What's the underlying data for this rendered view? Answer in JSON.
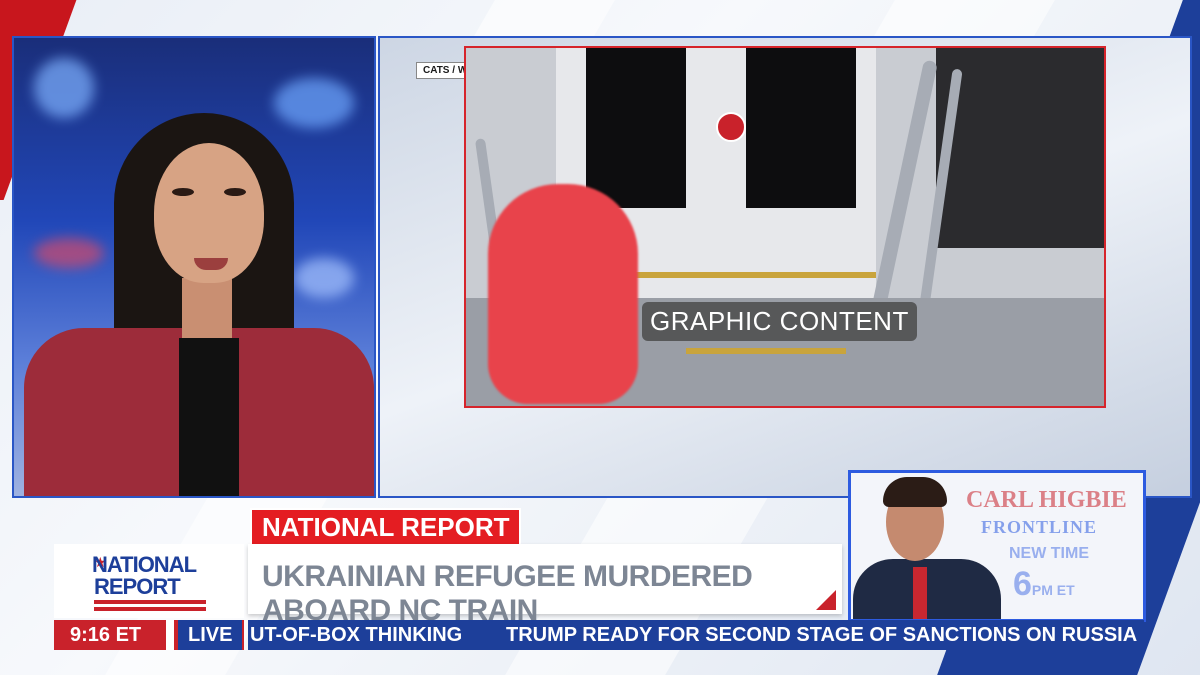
{
  "video": {
    "source_credit": "CATS / WBTV",
    "overlay_warning": "GRAPHIC CONTENT"
  },
  "lower_third": {
    "section": "NATIONAL REPORT",
    "headline": "UKRAINIAN REFUGEE MURDERED ABOARD NC TRAIN"
  },
  "logo": {
    "line1": "NATIONAL",
    "line2": "REPORT"
  },
  "status_bar": {
    "time": "9:16 ET",
    "live": "LIVE"
  },
  "ticker": {
    "items": [
      "UT-OF-BOX THINKING",
      "TRUMP READY FOR SECOND STAGE OF SANCTIONS ON RUSSIA"
    ]
  },
  "promo": {
    "title_line1": "CARL HIGBIE",
    "title_line2": "FRONTLINE",
    "new_time_label": "NEW TIME",
    "time_value": "6",
    "time_suffix": "PM ET"
  },
  "colors": {
    "brand_red": "#c9222b",
    "brand_blue": "#1d3f9a",
    "frame_blue": "#2a56c6"
  }
}
